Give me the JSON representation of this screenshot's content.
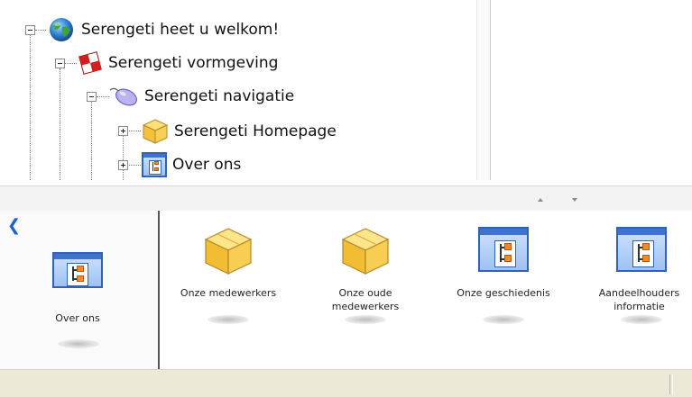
{
  "tree": {
    "nodes": [
      {
        "label": "Serengeti heet u welkom!",
        "icon": "globe-icon",
        "expanded": true
      },
      {
        "label": "Serengeti vormgeving",
        "icon": "checkered-flag-icon",
        "expanded": true
      },
      {
        "label": "Serengeti navigatie",
        "icon": "mouse-icon",
        "expanded": true
      },
      {
        "label": "Serengeti Homepage",
        "icon": "package-box-icon",
        "expanded": false
      },
      {
        "label": "Over ons",
        "icon": "org-chart-icon",
        "expanded": false
      }
    ]
  },
  "panel": {
    "back_icon": "back-arrow-icon",
    "current": {
      "label": "Over ons",
      "icon": "org-chart-icon"
    },
    "items": [
      {
        "label": "Onze medewerkers",
        "icon": "package-box-icon"
      },
      {
        "label": "Onze oude medewerkers",
        "label_line1": "Onze oude",
        "label_line2": "medewerkers",
        "icon": "package-box-icon"
      },
      {
        "label": "Onze geschiedenis",
        "icon": "org-chart-icon"
      },
      {
        "label": "Aandeelhouders informatie",
        "label_line1": "Aandeelhouders",
        "label_line2": "informatie",
        "icon": "org-chart-icon"
      }
    ]
  },
  "colors": {
    "accent": "#1c5fd6",
    "box": "#f5c542",
    "statusbar": "#ece9d8"
  }
}
